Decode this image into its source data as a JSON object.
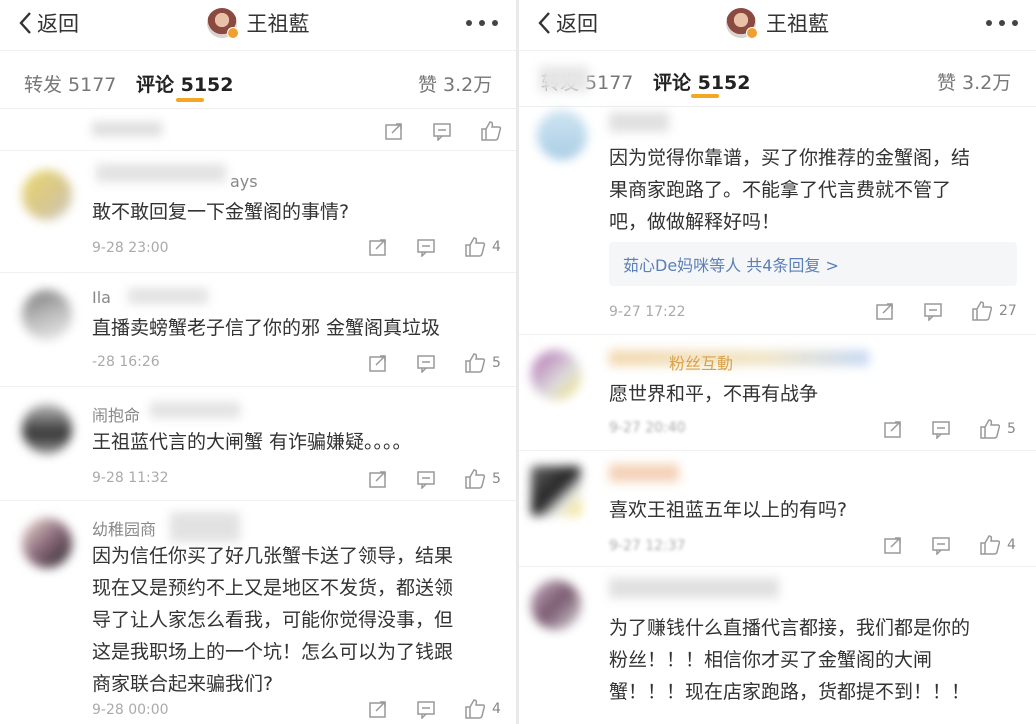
{
  "left": {
    "nav": {
      "back_label": "返回",
      "title": "王祖藍"
    },
    "tabs": {
      "repost": "转发 5177",
      "comments": "评论 5152",
      "likes": "赞 3.2万"
    },
    "comments": [
      {
        "name": "ays",
        "text": [
          "敢不敢回复一下金蟹阁的事情?"
        ],
        "time": "9-28 23:00",
        "likes": "4"
      },
      {
        "name": "Ila",
        "text": [
          "直播卖螃蟹老子信了你的邪 金蟹阁真垃圾"
        ],
        "time": "-28 16:26",
        "likes": "5"
      },
      {
        "name": "闹抱命",
        "text": [
          "王祖蓝代言的大闸蟹 有诈骗嫌疑。。。。"
        ],
        "time": "9-28 11:32",
        "likes": "5"
      },
      {
        "name": "幼稚园商",
        "text": [
          "因为信任你买了好几张蟹卡送了领导，结果",
          "现在又是预约不上又是地区不发货，都送领",
          "导了让人家怎么看我，可能你觉得没事，但",
          "这是我职场上的一个坑！怎么可以为了钱跟",
          "商家联合起来骗我们?"
        ],
        "time": "9-28 00:00",
        "likes": "4"
      }
    ]
  },
  "right": {
    "nav": {
      "back_label": "返回",
      "title": "王祖藍"
    },
    "tabs": {
      "repost": "转发 5177",
      "comments": "评论 5152",
      "likes": "赞 3.2万"
    },
    "comments": [
      {
        "name": "",
        "text": [
          "因为觉得你靠谱，买了你推荐的金蟹阁，结",
          "果商家跑路了。不能拿了代言费就不管了",
          "吧，做做解释好吗！"
        ],
        "reply": "茹心De妈咪等人 共4条回复 >",
        "time": "9-27 17:22",
        "likes": "27"
      },
      {
        "name": "粉丝互動",
        "text": [
          "愿世界和平，不再有战争"
        ],
        "time": "9-27 20:40",
        "likes": "5"
      },
      {
        "name": "",
        "text": [
          "喜欢王祖蓝五年以上的有吗?"
        ],
        "time": "9-27 12:37",
        "likes": "4"
      },
      {
        "name": "",
        "text": [
          "为了赚钱什么直播代言都接，我们都是你的",
          "粉丝！！！相信你才买了金蟹阁的大闸",
          "蟹！！！现在店家跑路，货都提不到！！！"
        ],
        "time": "",
        "likes": ""
      }
    ]
  }
}
